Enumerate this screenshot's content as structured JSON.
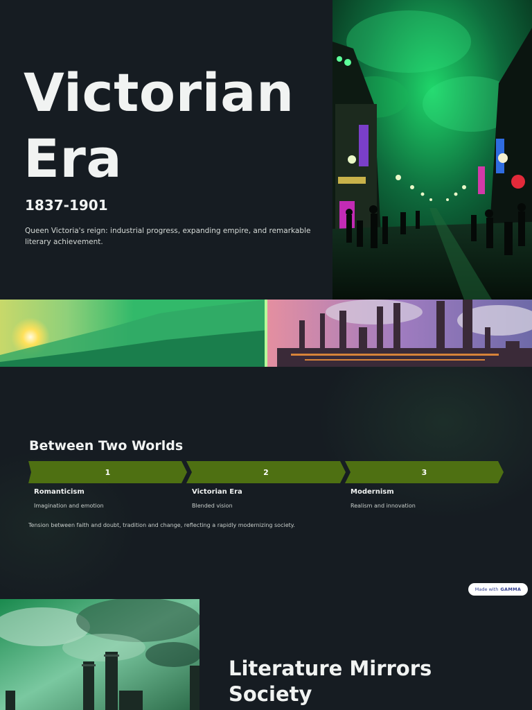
{
  "hero": {
    "title": "Victorian Era",
    "dates": "1837-1901",
    "description": "Queen Victoria's reign: industrial progress, expanding empire, and remarkable literary achievement.",
    "image_icon": "victorian-street-image"
  },
  "banner": {
    "image_icon": "landscape-to-industry-image"
  },
  "between": {
    "title": "Between Two Worlds",
    "steps": [
      {
        "number": "1",
        "name": "Romanticism",
        "desc": "Imagination and emotion"
      },
      {
        "number": "2",
        "name": "Victorian Era",
        "desc": "Blended vision"
      },
      {
        "number": "3",
        "name": "Modernism",
        "desc": "Realism and innovation"
      }
    ],
    "note": "Tension between faith and doubt, tradition and change, reflecting a rapidly modernizing society.",
    "badge_prefix": "Made with",
    "badge_brand": "GAMMA"
  },
  "literature": {
    "title": "Literature Mirrors Society",
    "image_icon": "factory-smokestacks-image"
  },
  "colors": {
    "background": "#161c22",
    "step_green": "#4e7012",
    "neon_green": "#29d36b",
    "text": "#f1f3f2"
  }
}
